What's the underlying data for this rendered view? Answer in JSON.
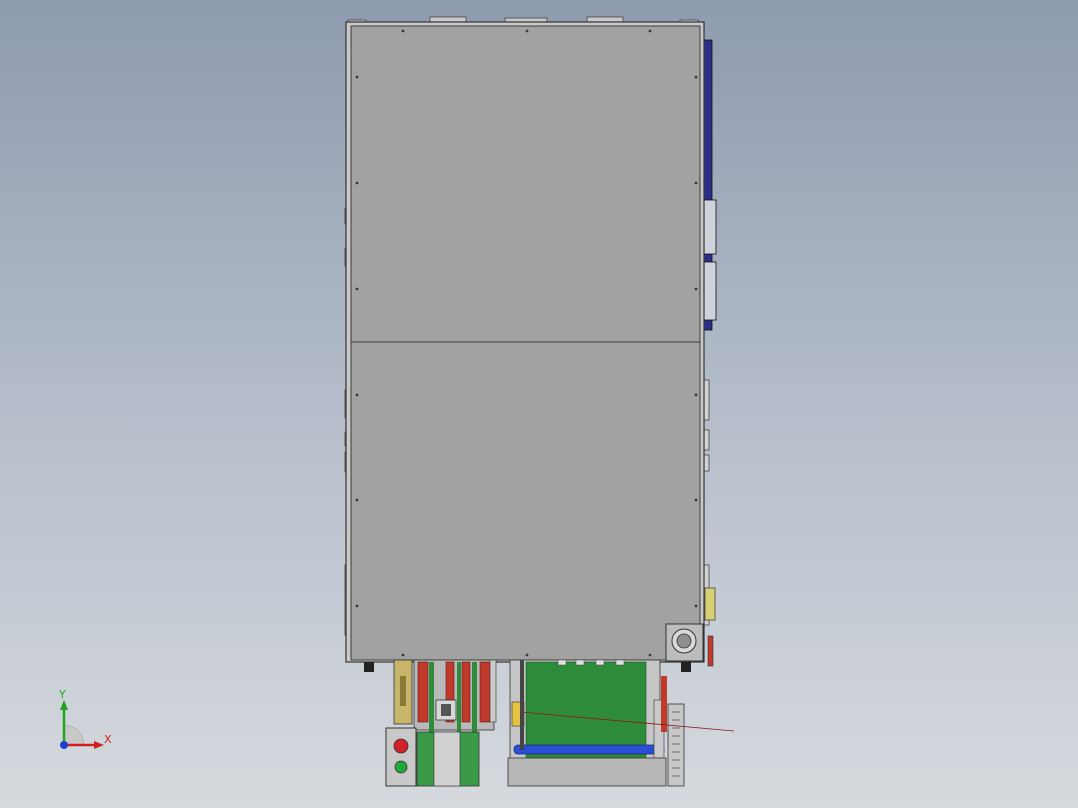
{
  "viewport": {
    "background_top": "#8e9aae",
    "background_bottom": "#d6dade"
  },
  "model": {
    "panel_color": "#a2a2a2",
    "frame_color": "#c9c9c9",
    "conveyor_color": "#2e8b3a",
    "rail_color": "#c0392b",
    "roller_color": "#2a4fd6",
    "side_panel_color": "#2b2f8a",
    "indicator_red": "#d0202a",
    "indicator_green": "#1fa83c"
  },
  "triad": {
    "x_label": "X",
    "y_label": "Y",
    "x_color": "#d11f1f",
    "y_color": "#1fa51f",
    "z_color": "#1f3fd1"
  }
}
